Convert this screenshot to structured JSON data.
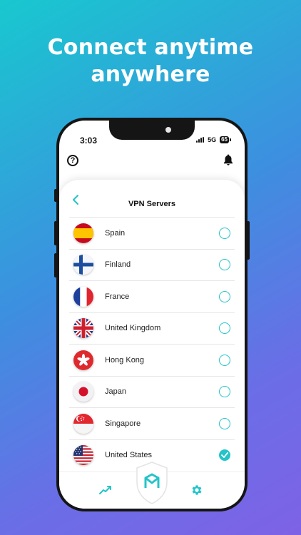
{
  "headline": {
    "line1": "Connect anytime",
    "line2": "anywhere"
  },
  "status_bar": {
    "time": "3:03",
    "network": "5G",
    "battery": "65"
  },
  "header": {
    "help_icon_glyph": "?",
    "notifications_icon": "bell-icon"
  },
  "vpn_screen": {
    "title": "VPN Servers",
    "back_icon": "chevron-left-icon",
    "servers": [
      {
        "name": "Spain",
        "flag": "spain-flag-icon",
        "selected": false
      },
      {
        "name": "Finland",
        "flag": "finland-flag-icon",
        "selected": false
      },
      {
        "name": "France",
        "flag": "france-flag-icon",
        "selected": false
      },
      {
        "name": "United Kingdom",
        "flag": "uk-flag-icon",
        "selected": false
      },
      {
        "name": "Hong Kong",
        "flag": "hong-kong-flag-icon",
        "selected": false
      },
      {
        "name": "Japan",
        "flag": "japan-flag-icon",
        "selected": false
      },
      {
        "name": "Singapore",
        "flag": "singapore-flag-icon",
        "selected": false
      },
      {
        "name": "United States",
        "flag": "us-flag-icon",
        "selected": true
      }
    ]
  },
  "tabbar": {
    "items": [
      "stats-icon",
      "shield-logo-icon",
      "gear-icon"
    ]
  },
  "colors": {
    "accent": "#24c4c8",
    "gradient_start": "#18c8cf",
    "gradient_end": "#7e62e6"
  }
}
